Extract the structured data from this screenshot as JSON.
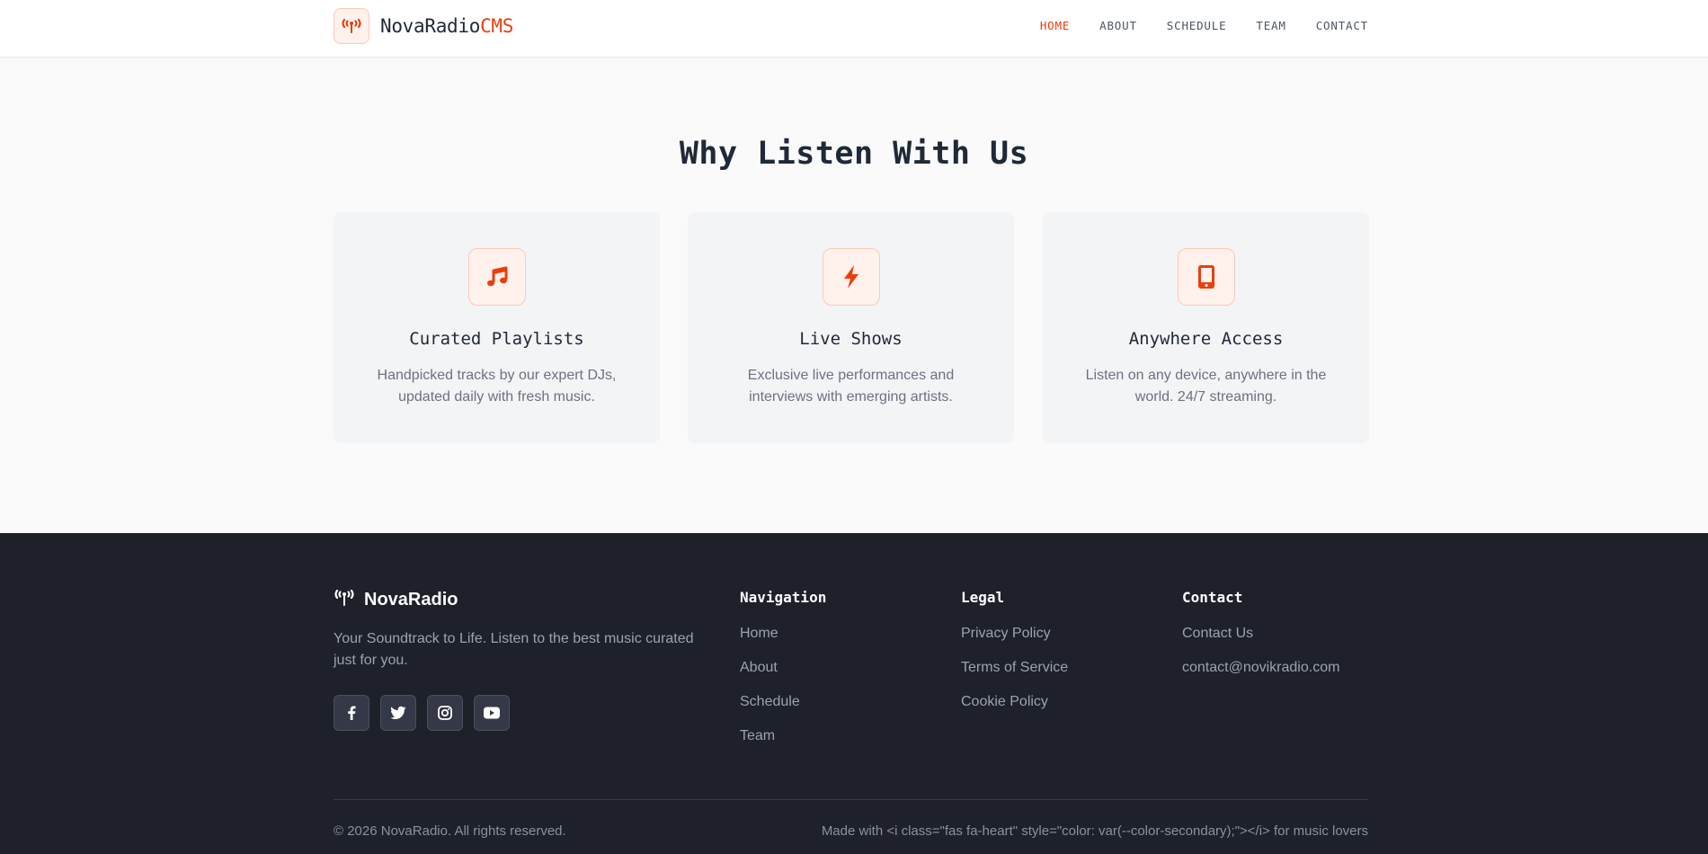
{
  "header": {
    "brand_name": "NovaRadio",
    "brand_accent": "CMS",
    "brand_icon": "broadcast-tower-icon",
    "nav": [
      {
        "label": "HOME",
        "active": true
      },
      {
        "label": "ABOUT",
        "active": false
      },
      {
        "label": "SCHEDULE",
        "active": false
      },
      {
        "label": "TEAM",
        "active": false
      },
      {
        "label": "CONTACT",
        "active": false
      }
    ]
  },
  "features": {
    "title": "Why Listen With Us",
    "cards": [
      {
        "icon": "music-icon",
        "title": "Curated Playlists",
        "description": "Handpicked tracks by our expert DJs, updated daily with fresh music."
      },
      {
        "icon": "bolt-icon",
        "title": "Live Shows",
        "description": "Exclusive live performances and interviews with emerging artists."
      },
      {
        "icon": "mobile-icon",
        "title": "Anywhere Access",
        "description": "Listen on any device, anywhere in the world. 24/7 streaming."
      }
    ]
  },
  "footer": {
    "brand_name": "NovaRadio",
    "tagline": "Your Soundtrack to Life. Listen to the best music curated just for you.",
    "socials": [
      "facebook-icon",
      "twitter-icon",
      "instagram-icon",
      "youtube-icon"
    ],
    "columns": [
      {
        "heading": "Navigation",
        "links": [
          "Home",
          "About",
          "Schedule",
          "Team"
        ]
      },
      {
        "heading": "Legal",
        "links": [
          "Privacy Policy",
          "Terms of Service",
          "Cookie Policy"
        ]
      },
      {
        "heading": "Contact",
        "links": [
          "Contact Us",
          "contact@novikradio.com"
        ]
      }
    ],
    "copyright": "© 2026 NovaRadio. All rights reserved.",
    "made_with": "Made with <i class=\"fas fa-heart\" style=\"color: var(--color-secondary);\"></i> for music lovers"
  },
  "colors": {
    "accent": "#ea3e0c",
    "footer_bg": "#1e202a",
    "card_bg": "#f3f4f6"
  }
}
